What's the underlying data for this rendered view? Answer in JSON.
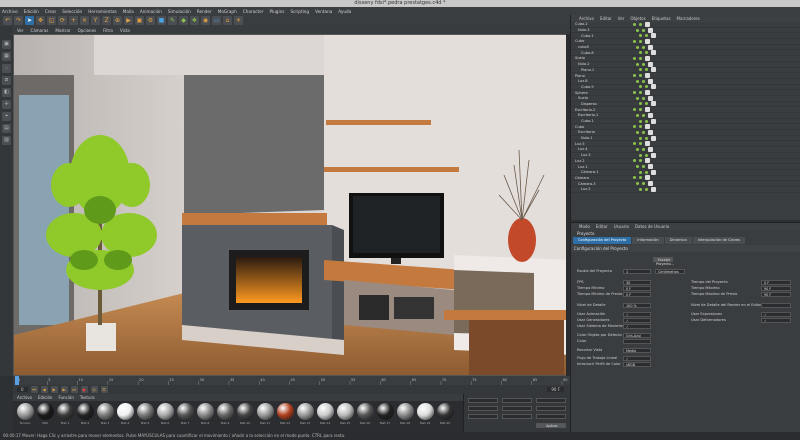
{
  "window_title": "disseny fdsi*.pedra prestatges.c4d *",
  "menu": [
    "Archivo",
    "Edición",
    "Crear",
    "Selección",
    "Herramientas",
    "Malla",
    "Animación",
    "Simulación",
    "Render",
    "MoGraph",
    "Character",
    "Plugins",
    "Scripting",
    "Ventana",
    "Ayuda"
  ],
  "layout": {
    "label": "Capa:",
    "value": "Diseño de Arranque"
  },
  "viewport_menu": [
    "Ver",
    "Cámaras",
    "Mostrar",
    "Opciones",
    "Filtro",
    "Vista"
  ],
  "object_manager": {
    "menu": [
      "Archivo",
      "Editar",
      "Ver",
      "Objetos",
      "Etiquetas",
      "Marcadores"
    ],
    "items": [
      "Cubo.2",
      "Nulo.3",
      "Cubo.1",
      "Cubo",
      "cubo5",
      "Cubo.8",
      "Suelo",
      "Nulo.2",
      "Plano.1",
      "Plano",
      "Luz.8",
      "Cubo.9",
      "Sphere",
      "Suelo",
      "Disperso",
      "Escritorio.2",
      "Escritorio.1",
      "Cubo.1",
      "Cubo",
      "Escritorio",
      "Nulo.1",
      "Luz.5",
      "Luz.4",
      "Luz.3",
      "Luz.2",
      "Luz.1",
      "Cámara.1",
      "Cámara",
      "Cámara.3",
      "Luz.2"
    ]
  },
  "attribute_manager": {
    "menu": [
      "Modo",
      "Editar",
      "Usuario",
      "Datos de Usuario"
    ],
    "title": "Proyecto",
    "tabs": [
      "Configuración del Proyecto",
      "Información",
      "Dinámica",
      "Interpolación de Claves"
    ],
    "section": "Configuración del Proyecto",
    "rows_left": [
      {
        "label": "Escala del Proyecto",
        "value": "1",
        "unit": "Centímetros"
      },
      {
        "label": "FPS",
        "value": "30"
      },
      {
        "label": "Tiempo Mínimo",
        "value": "0 F"
      },
      {
        "label": "Tiempo Mínimo de Previo",
        "value": "0 F"
      },
      {
        "label": "Nivel de Detalle",
        "value": "100 %"
      },
      {
        "label": "Usar Animación",
        "value": "✓"
      },
      {
        "label": "Usar Generadores",
        "value": "✓"
      },
      {
        "label": "Usar Sistema de Movimiento",
        "value": "✓"
      },
      {
        "label": "Color Objeto por Defecto",
        "value": "Gris-Azul"
      },
      {
        "label": "Color",
        "value": ""
      },
      {
        "label": "Recortar Vista",
        "value": "Medio"
      },
      {
        "label": "Flujo de Trabajo Lineal",
        "value": "✓"
      },
      {
        "label": "Introducir Perfil de Color",
        "value": "sRGB"
      }
    ],
    "rows_right": [
      {
        "label": "Tiempo del Proyecto",
        "value": "0 F"
      },
      {
        "label": "Tiempo Máximo",
        "value": "90 F"
      },
      {
        "label": "Tiempo Máximo de Previo",
        "value": "90 F"
      },
      {
        "label": "Nivel de Detalle del Render en el Editor",
        "value": ""
      },
      {
        "label": "Usar Expresiones",
        "value": "✓"
      },
      {
        "label": "Usar Deformadores",
        "value": "✓"
      }
    ],
    "scale_button": "Escalar Proyecto..."
  },
  "timeline": {
    "start": "0",
    "end": "90 F",
    "ticks": [
      "0",
      "5",
      "10",
      "15",
      "20",
      "25",
      "30",
      "35",
      "40",
      "45",
      "50",
      "55",
      "60",
      "65",
      "70",
      "75",
      "80",
      "85",
      "90"
    ]
  },
  "material_menu": [
    "Archivo",
    "Edición",
    "Función",
    "Textura"
  ],
  "materials": [
    {
      "name": "Terrazo",
      "color": "#9a9a9a"
    },
    {
      "name": "Mat",
      "color": "#1a1a1a"
    },
    {
      "name": "Mat.1",
      "color": "#3a3a3a"
    },
    {
      "name": "Mat.2",
      "color": "#222"
    },
    {
      "name": "Mat.3",
      "color": "#7a7a7a"
    },
    {
      "name": "Mat.4",
      "color": "#f0f0f0"
    },
    {
      "name": "Mat.5",
      "color": "#777"
    },
    {
      "name": "Mat.6",
      "color": "#aaa"
    },
    {
      "name": "Mat.7",
      "color": "#555"
    },
    {
      "name": "Mat.8",
      "color": "#888"
    },
    {
      "name": "Mat.9",
      "color": "#666"
    },
    {
      "name": "Mat.10",
      "color": "#444"
    },
    {
      "name": "Mat.11",
      "color": "#999"
    },
    {
      "name": "Mat.12",
      "color": "#b04020"
    },
    {
      "name": "Mat.13",
      "color": "#999"
    },
    {
      "name": "Mat.14",
      "color": "#ccc"
    },
    {
      "name": "Mat.15",
      "color": "#bbb"
    },
    {
      "name": "Mat.16",
      "color": "#555"
    },
    {
      "name": "Mat.17",
      "color": "#222"
    },
    {
      "name": "Mat.18",
      "color": "#8a8a8a"
    },
    {
      "name": "Mat.19",
      "color": "#ddd"
    },
    {
      "name": "Mat.20",
      "color": "#333"
    }
  ],
  "coords": {
    "apply_label": "Aplicar"
  },
  "status": "00:00:17  Mover: Haga Clic y arrastre para mover elementos. Pulse MAYÚSCULAS para cuantificar el movimiento / añadir a la selección en el modo punto. CTRL para resta."
}
